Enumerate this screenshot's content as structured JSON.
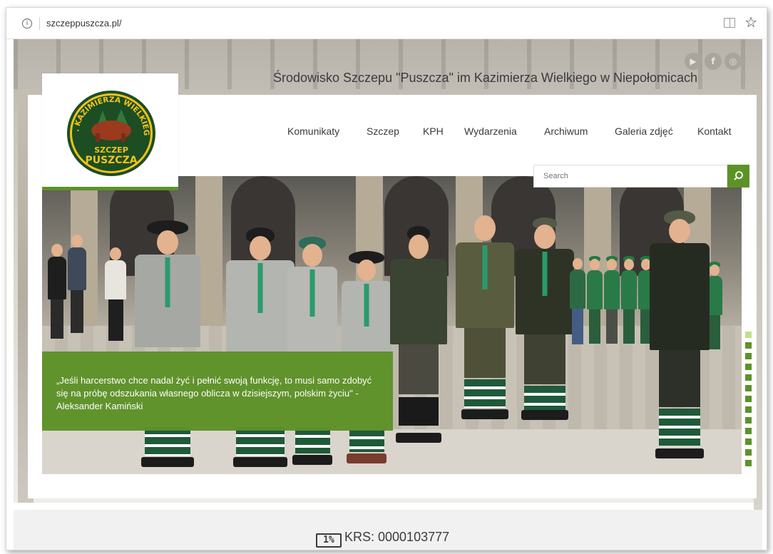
{
  "browser": {
    "url": "szczeppuszcza.pl/"
  },
  "header": {
    "tagline": "Środowisko Szczepu \"Puszcza\" im Kazimierza Wielkiego w Niepołomicach",
    "social_icons": [
      "youtube-icon",
      "facebook-icon",
      "instagram-icon"
    ]
  },
  "logo": {
    "top_arc": "IM. KAZIMIERZA WIELKIEGO",
    "line1": "SZCZEP",
    "line2": "PUSZCZA"
  },
  "nav": {
    "items": [
      {
        "label": "Komunikaty"
      },
      {
        "label": "Szczep"
      },
      {
        "label": "KPH"
      },
      {
        "label": "Wydarzenia"
      },
      {
        "label": "Archiwum"
      },
      {
        "label": "Galeria zdjęć"
      },
      {
        "label": "Kontakt"
      }
    ]
  },
  "search": {
    "placeholder": "Search"
  },
  "hero": {
    "quote": "„Jeśli harcerstwo chce nadal żyć i pełnić swoją funkcję, to musi samo zdobyć się na próbę odszukania własnego oblicza w dzisiejszym, polskim życiu\" - Aleksander Kamiński",
    "slide_count": 13,
    "active_slide": 1
  },
  "footer": {
    "krs_icon_text": "1%",
    "krs_text": "KRS: 0000103777"
  },
  "colors": {
    "accent_green": "#5d9228",
    "text_dark": "#3b3b3b"
  }
}
